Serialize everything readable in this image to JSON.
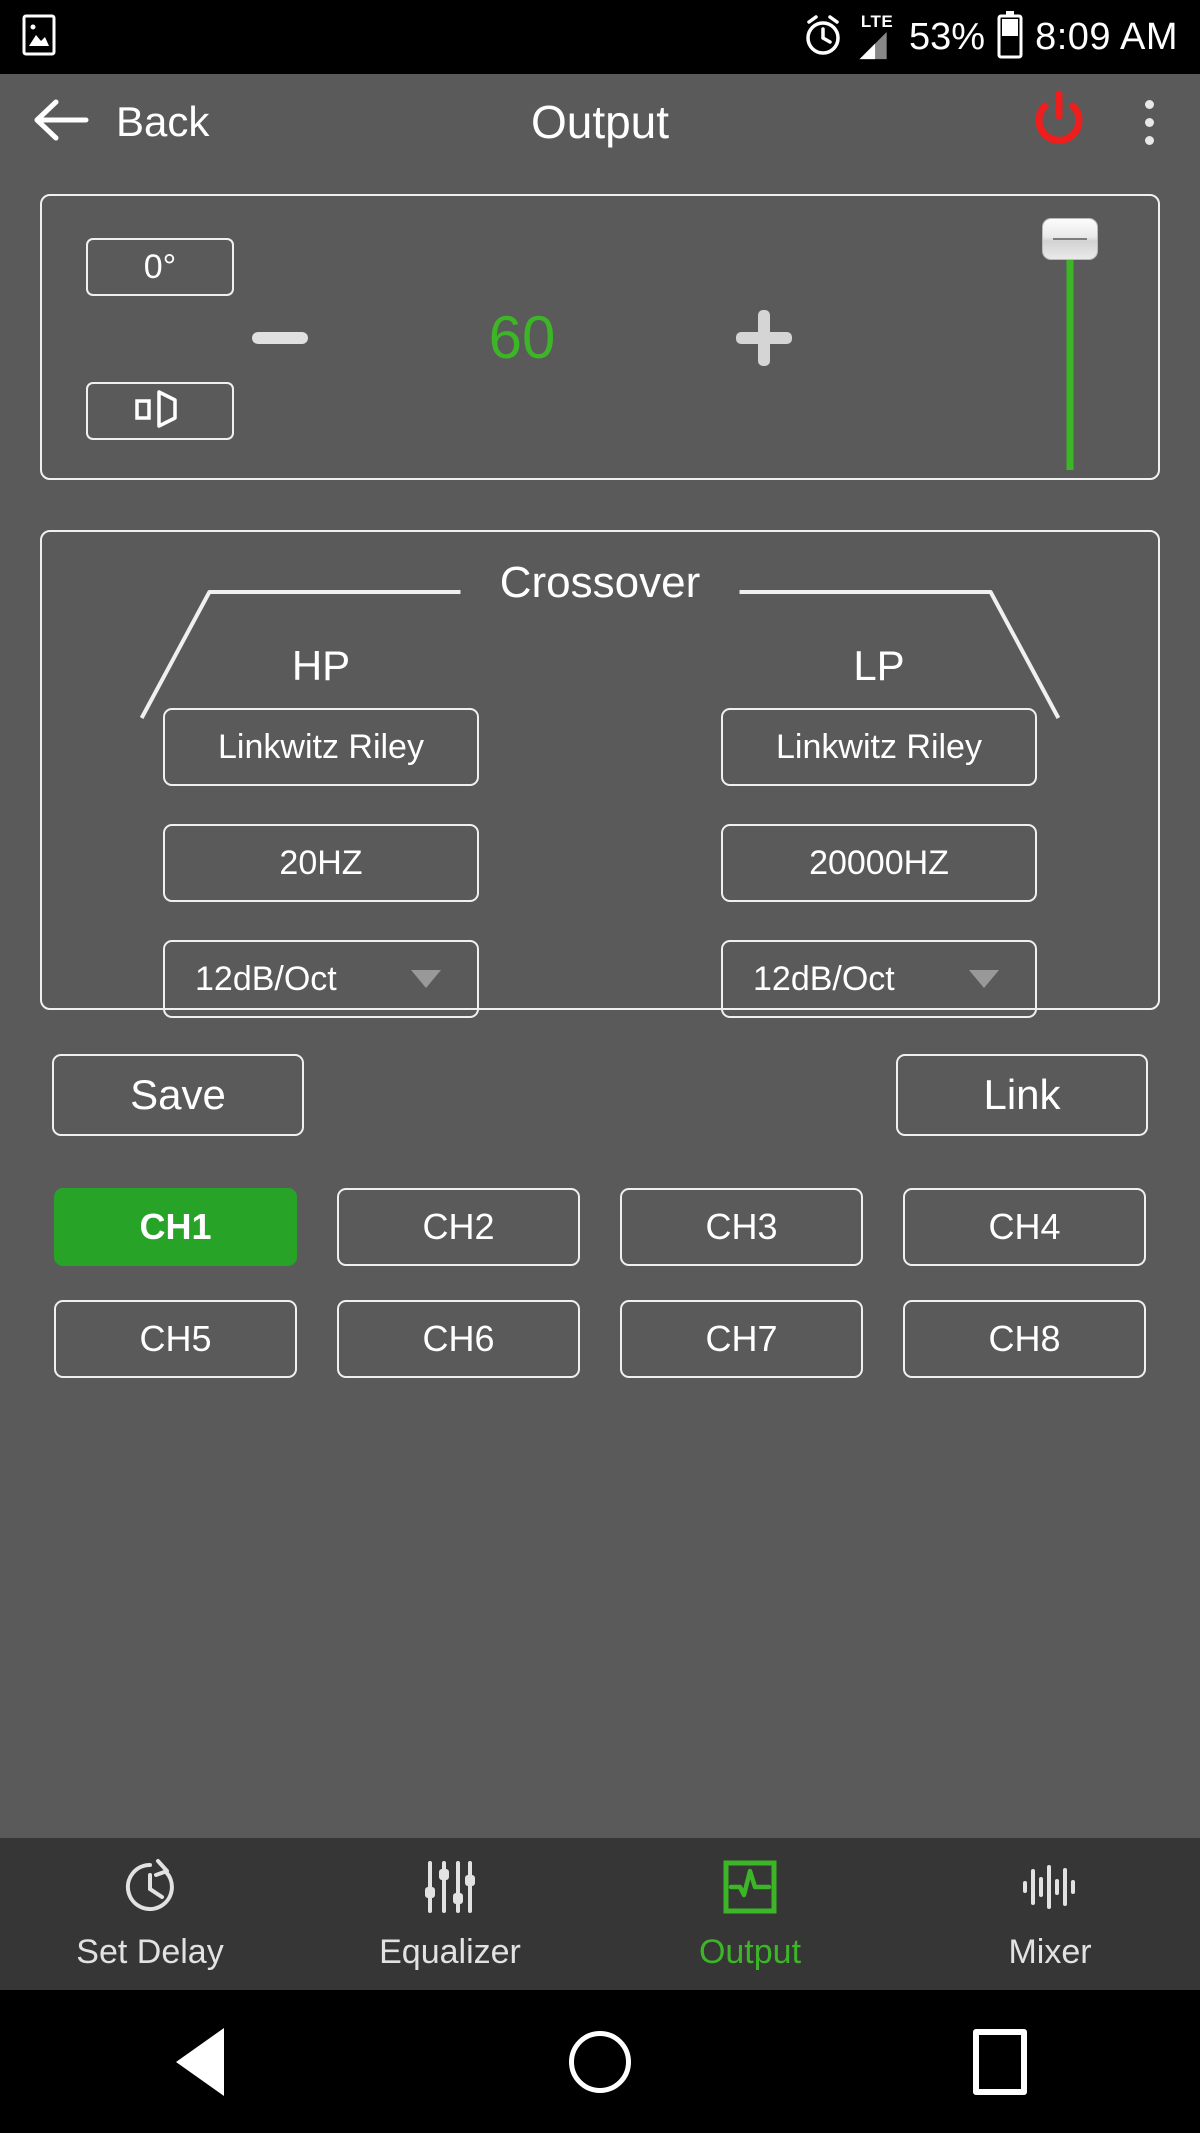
{
  "status_bar": {
    "gallery_icon": "image-icon",
    "alarm_icon": "alarm-clock-icon",
    "network_label": "LTE",
    "signal_icon": "signal-bars-icon",
    "battery_percent": "53%",
    "battery_icon": "battery-icon",
    "time": "8:09 AM"
  },
  "app_bar": {
    "back_icon": "arrow-left-icon",
    "back_label": "Back",
    "title": "Output",
    "power_icon": "power-icon",
    "power_color": "#f01d1d",
    "overflow_icon": "kebab-menu-icon"
  },
  "gain_panel": {
    "phase_label": "0°",
    "speaker_icon": "speaker-icon",
    "minus_label": "−",
    "value": "60",
    "value_color": "#3cb527",
    "plus_label": "+",
    "slider": {
      "icon": "vertical-slider",
      "fill_color": "#3cb527",
      "thumb_position": "top"
    }
  },
  "crossover": {
    "title": "Crossover",
    "hp_label": "HP",
    "lp_label": "LP",
    "hp": {
      "filter_type": "Linkwitz Riley",
      "frequency": "20HZ",
      "slope": "12dB/Oct"
    },
    "lp": {
      "filter_type": "Linkwitz Riley",
      "frequency": "20000HZ",
      "slope": "12dB/Oct"
    }
  },
  "actions": {
    "save_label": "Save",
    "link_label": "Link"
  },
  "channels": {
    "active_color": "#27a327",
    "items": [
      {
        "label": "CH1",
        "active": true
      },
      {
        "label": "CH2",
        "active": false
      },
      {
        "label": "CH3",
        "active": false
      },
      {
        "label": "CH4",
        "active": false
      },
      {
        "label": "CH5",
        "active": false
      },
      {
        "label": "CH6",
        "active": false
      },
      {
        "label": "CH7",
        "active": false
      },
      {
        "label": "CH8",
        "active": false
      }
    ]
  },
  "tab_bar": {
    "active_color": "#3cb527",
    "items": [
      {
        "label": "Set Delay",
        "icon": "clock-refresh-icon",
        "active": false
      },
      {
        "label": "Equalizer",
        "icon": "equalizer-sliders-icon",
        "active": false
      },
      {
        "label": "Output",
        "icon": "waveform-box-icon",
        "active": true
      },
      {
        "label": "Mixer",
        "icon": "audio-bars-icon",
        "active": false
      }
    ]
  },
  "android_nav": {
    "back_icon": "nav-back-triangle-icon",
    "home_icon": "nav-home-circle-icon",
    "recents_icon": "nav-recents-square-icon"
  }
}
